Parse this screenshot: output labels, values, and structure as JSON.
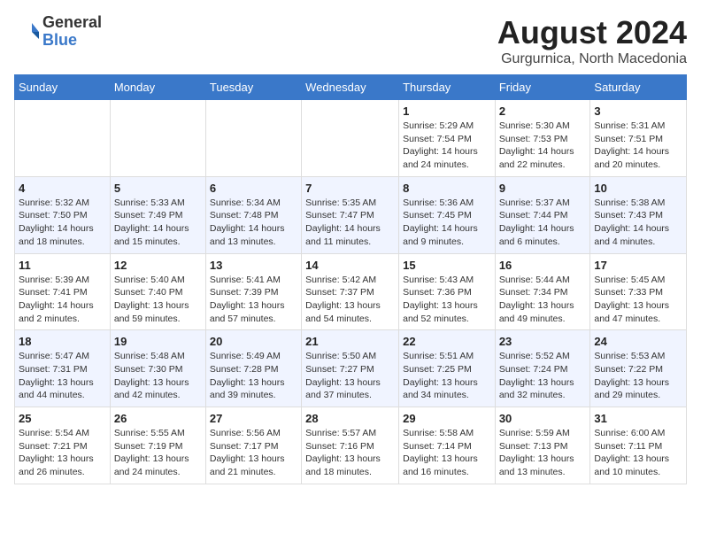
{
  "header": {
    "logo_line1": "General",
    "logo_line2": "Blue",
    "main_title": "August 2024",
    "subtitle": "Gurgurnica, North Macedonia"
  },
  "calendar": {
    "weekdays": [
      "Sunday",
      "Monday",
      "Tuesday",
      "Wednesday",
      "Thursday",
      "Friday",
      "Saturday"
    ],
    "weeks": [
      [
        {
          "day": "",
          "info": ""
        },
        {
          "day": "",
          "info": ""
        },
        {
          "day": "",
          "info": ""
        },
        {
          "day": "",
          "info": ""
        },
        {
          "day": "1",
          "info": "Sunrise: 5:29 AM\nSunset: 7:54 PM\nDaylight: 14 hours and 24 minutes."
        },
        {
          "day": "2",
          "info": "Sunrise: 5:30 AM\nSunset: 7:53 PM\nDaylight: 14 hours and 22 minutes."
        },
        {
          "day": "3",
          "info": "Sunrise: 5:31 AM\nSunset: 7:51 PM\nDaylight: 14 hours and 20 minutes."
        }
      ],
      [
        {
          "day": "4",
          "info": "Sunrise: 5:32 AM\nSunset: 7:50 PM\nDaylight: 14 hours and 18 minutes."
        },
        {
          "day": "5",
          "info": "Sunrise: 5:33 AM\nSunset: 7:49 PM\nDaylight: 14 hours and 15 minutes."
        },
        {
          "day": "6",
          "info": "Sunrise: 5:34 AM\nSunset: 7:48 PM\nDaylight: 14 hours and 13 minutes."
        },
        {
          "day": "7",
          "info": "Sunrise: 5:35 AM\nSunset: 7:47 PM\nDaylight: 14 hours and 11 minutes."
        },
        {
          "day": "8",
          "info": "Sunrise: 5:36 AM\nSunset: 7:45 PM\nDaylight: 14 hours and 9 minutes."
        },
        {
          "day": "9",
          "info": "Sunrise: 5:37 AM\nSunset: 7:44 PM\nDaylight: 14 hours and 6 minutes."
        },
        {
          "day": "10",
          "info": "Sunrise: 5:38 AM\nSunset: 7:43 PM\nDaylight: 14 hours and 4 minutes."
        }
      ],
      [
        {
          "day": "11",
          "info": "Sunrise: 5:39 AM\nSunset: 7:41 PM\nDaylight: 14 hours and 2 minutes."
        },
        {
          "day": "12",
          "info": "Sunrise: 5:40 AM\nSunset: 7:40 PM\nDaylight: 13 hours and 59 minutes."
        },
        {
          "day": "13",
          "info": "Sunrise: 5:41 AM\nSunset: 7:39 PM\nDaylight: 13 hours and 57 minutes."
        },
        {
          "day": "14",
          "info": "Sunrise: 5:42 AM\nSunset: 7:37 PM\nDaylight: 13 hours and 54 minutes."
        },
        {
          "day": "15",
          "info": "Sunrise: 5:43 AM\nSunset: 7:36 PM\nDaylight: 13 hours and 52 minutes."
        },
        {
          "day": "16",
          "info": "Sunrise: 5:44 AM\nSunset: 7:34 PM\nDaylight: 13 hours and 49 minutes."
        },
        {
          "day": "17",
          "info": "Sunrise: 5:45 AM\nSunset: 7:33 PM\nDaylight: 13 hours and 47 minutes."
        }
      ],
      [
        {
          "day": "18",
          "info": "Sunrise: 5:47 AM\nSunset: 7:31 PM\nDaylight: 13 hours and 44 minutes."
        },
        {
          "day": "19",
          "info": "Sunrise: 5:48 AM\nSunset: 7:30 PM\nDaylight: 13 hours and 42 minutes."
        },
        {
          "day": "20",
          "info": "Sunrise: 5:49 AM\nSunset: 7:28 PM\nDaylight: 13 hours and 39 minutes."
        },
        {
          "day": "21",
          "info": "Sunrise: 5:50 AM\nSunset: 7:27 PM\nDaylight: 13 hours and 37 minutes."
        },
        {
          "day": "22",
          "info": "Sunrise: 5:51 AM\nSunset: 7:25 PM\nDaylight: 13 hours and 34 minutes."
        },
        {
          "day": "23",
          "info": "Sunrise: 5:52 AM\nSunset: 7:24 PM\nDaylight: 13 hours and 32 minutes."
        },
        {
          "day": "24",
          "info": "Sunrise: 5:53 AM\nSunset: 7:22 PM\nDaylight: 13 hours and 29 minutes."
        }
      ],
      [
        {
          "day": "25",
          "info": "Sunrise: 5:54 AM\nSunset: 7:21 PM\nDaylight: 13 hours and 26 minutes."
        },
        {
          "day": "26",
          "info": "Sunrise: 5:55 AM\nSunset: 7:19 PM\nDaylight: 13 hours and 24 minutes."
        },
        {
          "day": "27",
          "info": "Sunrise: 5:56 AM\nSunset: 7:17 PM\nDaylight: 13 hours and 21 minutes."
        },
        {
          "day": "28",
          "info": "Sunrise: 5:57 AM\nSunset: 7:16 PM\nDaylight: 13 hours and 18 minutes."
        },
        {
          "day": "29",
          "info": "Sunrise: 5:58 AM\nSunset: 7:14 PM\nDaylight: 13 hours and 16 minutes."
        },
        {
          "day": "30",
          "info": "Sunrise: 5:59 AM\nSunset: 7:13 PM\nDaylight: 13 hours and 13 minutes."
        },
        {
          "day": "31",
          "info": "Sunrise: 6:00 AM\nSunset: 7:11 PM\nDaylight: 13 hours and 10 minutes."
        }
      ]
    ]
  }
}
